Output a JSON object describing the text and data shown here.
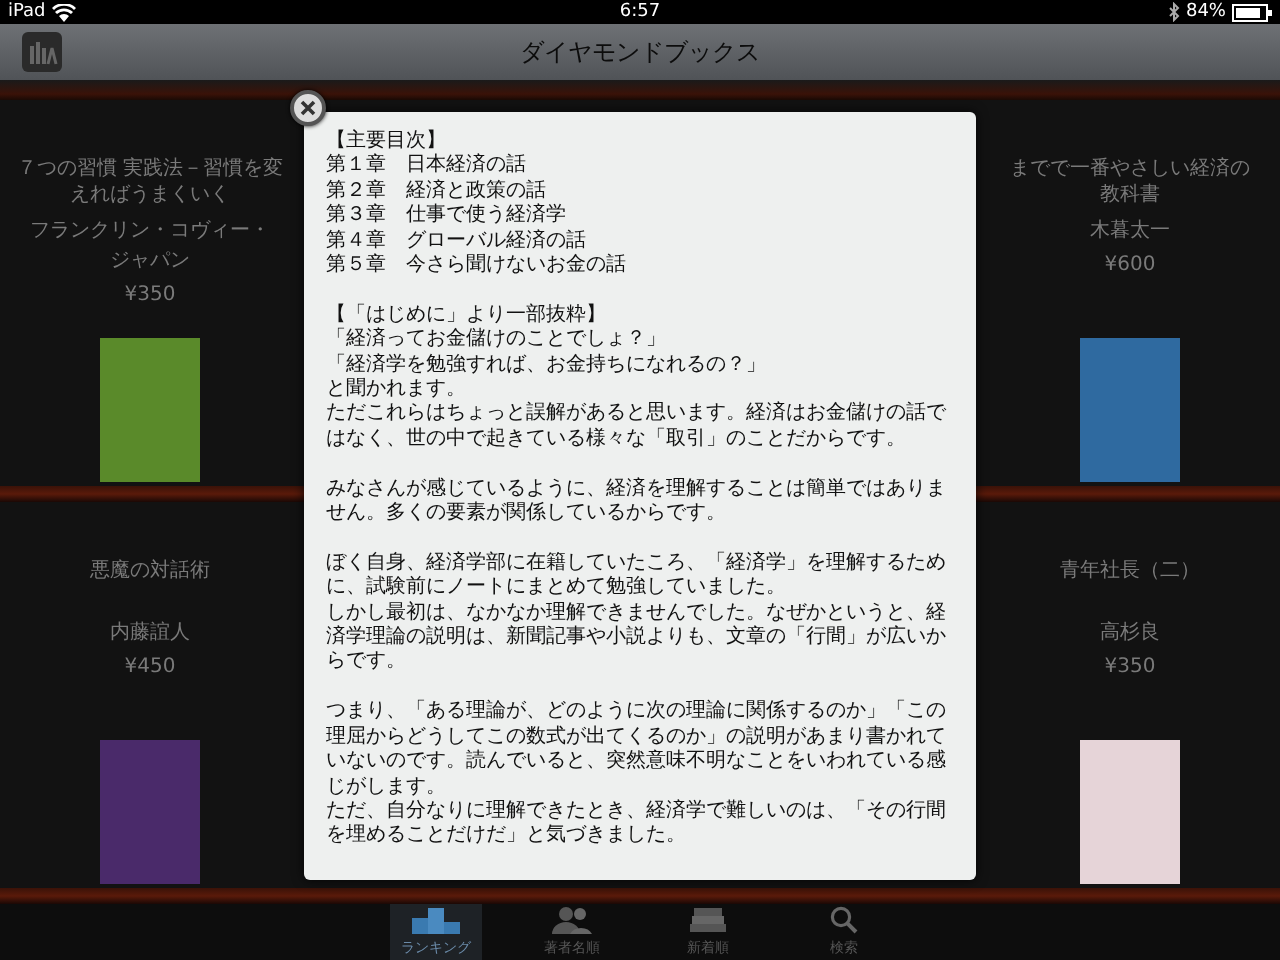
{
  "status_bar": {
    "device": "iPad",
    "time": "6:57",
    "battery": "84%"
  },
  "nav_bar": {
    "title": "ダイヤモンドブックス"
  },
  "shelf_rows": [
    {
      "left": {
        "title_lines": [
          "７つの習慣 実践法－習慣を変",
          "えればうまくいく"
        ],
        "author_lines": [
          "フランクリン・コヴィー・",
          "ジャパン"
        ],
        "price": "¥350",
        "color": "#5a8a2a"
      },
      "right": {
        "title_lines": [
          "までで一番やさしい経済の",
          "教科書"
        ],
        "author_lines": [
          "木暮太一"
        ],
        "price": "¥600",
        "color": "#2f6aa0"
      }
    },
    {
      "left": {
        "title_lines": [
          "悪魔の対話術"
        ],
        "author_lines": [
          "内藤誼人"
        ],
        "price": "¥450",
        "color": "#4a2a6a"
      },
      "right": {
        "title_lines": [
          "青年社長（二）"
        ],
        "author_lines": [
          "高杉良"
        ],
        "price": "¥350",
        "color": "#e6d4d8"
      }
    }
  ],
  "modal": {
    "paragraphs": [
      [
        "【主要目次】",
        "第１章　日本経済の話",
        "第２章　経済と政策の話",
        "第３章　仕事で使う経済学",
        "第４章　グローバル経済の話",
        "第５章　今さら聞けないお金の話"
      ],
      [
        "【「はじめに」より一部抜粋】",
        "「経済ってお金儲けのことでしょ？」",
        "「経済学を勉強すれば、お金持ちになれるの？」",
        "と聞かれます。",
        "ただこれらはちょっと誤解があると思います。経済はお金儲けの話で",
        "はなく、世の中で起きている様々な「取引」のことだからです。"
      ],
      [
        "みなさんが感じているように、経済を理解することは簡単ではありま",
        "せん。多くの要素が関係しているからです。"
      ],
      [
        "ぼく自身、経済学部に在籍していたころ、「経済学」を理解するため",
        "に、試験前にノートにまとめて勉強していました。",
        "しかし最初は、なかなか理解できませんでした。なぜかというと、経",
        "済学理論の説明は、新聞記事や小説よりも、文章の「行間」が広いか",
        "らです。"
      ],
      [
        "つまり、「ある理論が、どのように次の理論に関係するのか」「この",
        "理屈からどうしてこの数式が出てくるのか」の説明があまり書かれて",
        "いないのです。読んでいると、突然意味不明なことをいわれている感",
        "じがします。",
        "ただ、自分なりに理解できたとき、経済学で難しいのは、「その行間",
        "を埋めることだけだ」と気づきました。"
      ]
    ]
  },
  "tab_bar": [
    {
      "label": "ランキング",
      "kind": "podium",
      "selected": true
    },
    {
      "label": "著者名順",
      "kind": "people",
      "selected": false
    },
    {
      "label": "新着順",
      "kind": "books",
      "selected": false
    },
    {
      "label": "検索",
      "kind": "search",
      "selected": false
    }
  ]
}
